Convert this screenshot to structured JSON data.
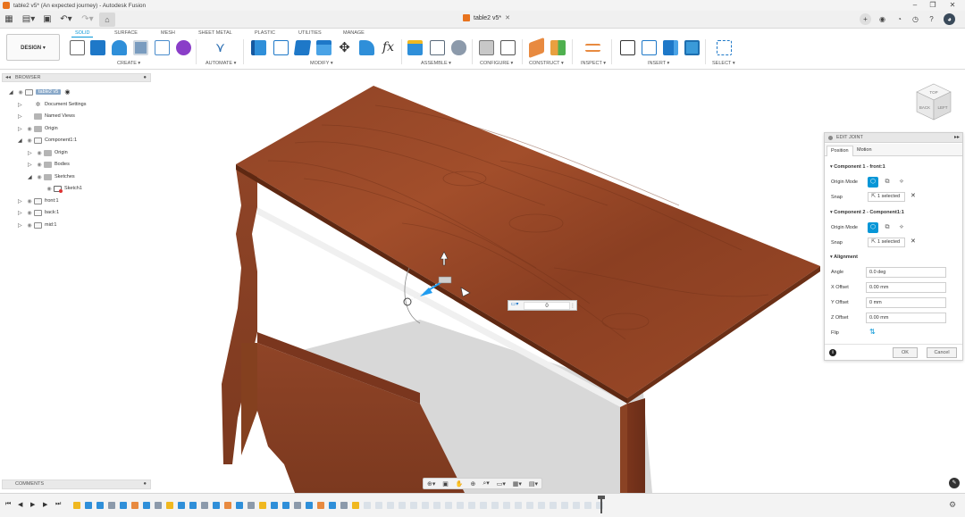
{
  "window": {
    "title": "table2 v5* (An expected journey) - Autodesk Fusion",
    "doc_tab": "table2 v5*"
  },
  "workspace": "DESIGN",
  "ribbon_tabs": [
    "SOLID",
    "SURFACE",
    "MESH",
    "SHEET METAL",
    "PLASTIC",
    "UTILITIES",
    "MANAGE"
  ],
  "ribbon_groups": [
    "CREATE",
    "AUTOMATE",
    "MODIFY",
    "ASSEMBLE",
    "CONFIGURE",
    "CONSTRUCT",
    "INSPECT",
    "INSERT",
    "SELECT"
  ],
  "browser": {
    "title": "BROWSER",
    "items": [
      {
        "label": "table2 v5",
        "kind": "root"
      },
      {
        "label": "Document Settings",
        "kind": "settings"
      },
      {
        "label": "Named Views",
        "kind": "folder"
      },
      {
        "label": "Origin",
        "kind": "folder"
      },
      {
        "label": "Component1:1",
        "kind": "component"
      },
      {
        "label": "Origin",
        "kind": "folder"
      },
      {
        "label": "Bodies",
        "kind": "folder"
      },
      {
        "label": "Sketches",
        "kind": "folder"
      },
      {
        "label": "Sketch1",
        "kind": "sketch"
      },
      {
        "label": "front:1",
        "kind": "component"
      },
      {
        "label": "back:1",
        "kind": "component"
      },
      {
        "label": "mid:1",
        "kind": "component"
      }
    ]
  },
  "comments": {
    "title": "COMMENTS"
  },
  "float_input": {
    "value": "0"
  },
  "edit_joint": {
    "title": "EDIT JOINT",
    "tabs": [
      "Position",
      "Motion"
    ],
    "component1": {
      "title": "Component 1 - front:1",
      "origin_mode_label": "Origin Mode",
      "snap_label": "Snap",
      "snap_value": "1 selected"
    },
    "component2": {
      "title": "Component 2 - Component1:1",
      "origin_mode_label": "Origin Mode",
      "snap_label": "Snap",
      "snap_value": "1 selected"
    },
    "alignment": {
      "title": "Alignment",
      "angle_label": "Angle",
      "angle_value": "0.0 deg",
      "x_label": "X Offset",
      "x_value": "0.00 mm",
      "y_label": "Y Offset",
      "y_value": "0 mm",
      "z_label": "Z Offset",
      "z_value": "0.00 mm",
      "flip_label": "Flip"
    },
    "ok_label": "OK",
    "cancel_label": "Cancel"
  },
  "viewcube": {
    "faces": [
      "TOP",
      "BACK",
      "LEFT"
    ]
  },
  "colors": {
    "accent": "#0696d7",
    "wood": "#8a3f22",
    "shadow": "#d5d5d5"
  }
}
